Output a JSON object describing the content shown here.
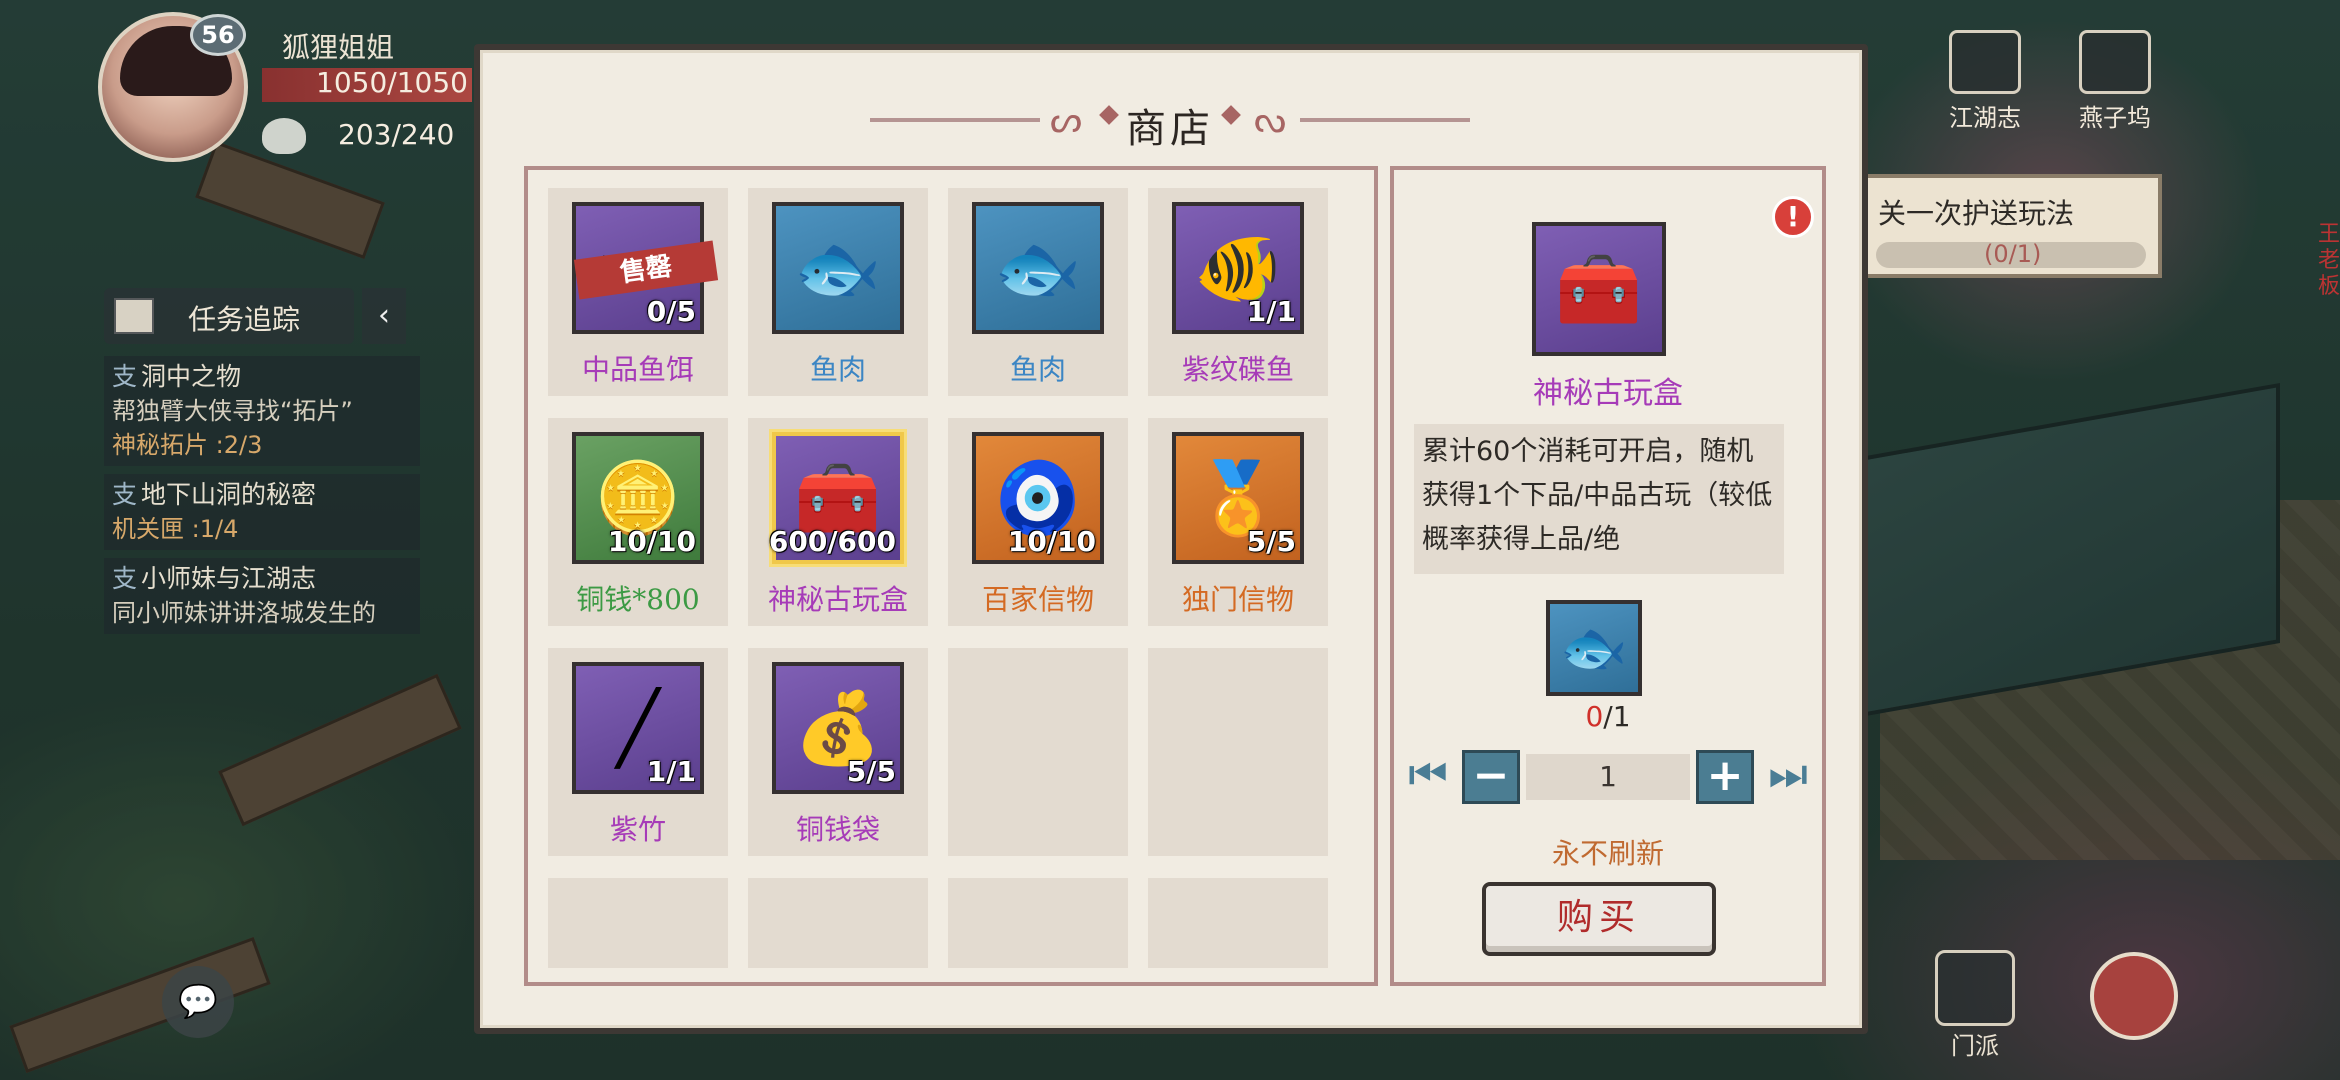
{
  "player": {
    "level": "56",
    "name": "狐狸姐姐",
    "hp": "1050/1050",
    "energy": "203/240"
  },
  "quest_tracker": {
    "header": "任务追踪",
    "collapse_icon": "chevron-left-icon",
    "quests": [
      {
        "tag": "支",
        "title": "洞中之物",
        "desc": "帮独臂大侠寻找“拓片”",
        "progress": "神秘拓片 :2/3"
      },
      {
        "tag": "支",
        "title": "地下山洞的秘密",
        "desc": "",
        "progress": "机关匣 :1/4"
      },
      {
        "tag": "支",
        "title": "小师妹与江湖志",
        "desc": "同小师妹讲讲洛城发生的",
        "progress": ""
      }
    ]
  },
  "hud_right": {
    "jianghu_label": "江湖志",
    "yanziwu_label": "燕子坞",
    "escort_text": "关一次护送玩法",
    "escort_progress": "(0/1)",
    "npc_name": "王老板",
    "sect_label": "门派"
  },
  "shop": {
    "title": "商店",
    "items": [
      {
        "name": "中品鱼饵",
        "stock": "0/5",
        "color": "purple",
        "frame": "purple",
        "icon": "bait-worm-icon",
        "soldout": "售罄",
        "glyph": "〰"
      },
      {
        "name": "鱼肉",
        "stock": "",
        "color": "blue",
        "frame": "blue",
        "icon": "fish-meat-icon",
        "glyph": "🐟"
      },
      {
        "name": "鱼肉",
        "stock": "",
        "color": "blue",
        "frame": "blue",
        "icon": "fish-meat-icon",
        "glyph": "🐟"
      },
      {
        "name": "紫纹碟鱼",
        "stock": "1/1",
        "color": "purple",
        "frame": "purple",
        "icon": "purple-fish-icon",
        "glyph": "🐠"
      },
      {
        "name": "铜钱*800",
        "stock": "10/10",
        "color": "green",
        "frame": "green",
        "icon": "copper-coin-icon",
        "glyph": "🪙"
      },
      {
        "name": "神秘古玩盒",
        "stock": "600/600",
        "color": "purple",
        "frame": "purple",
        "icon": "treasure-chest-icon",
        "glyph": "🧰",
        "selected": true
      },
      {
        "name": "百家信物",
        "stock": "10/10",
        "color": "orange",
        "frame": "orange",
        "icon": "jade-token-icon",
        "glyph": "🧿"
      },
      {
        "name": "独门信物",
        "stock": "5/5",
        "color": "orange",
        "frame": "orange",
        "icon": "jade-token-icon",
        "glyph": "🏅"
      },
      {
        "name": "紫竹",
        "stock": "1/1",
        "color": "purple",
        "frame": "purple",
        "icon": "bamboo-rod-icon",
        "glyph": "╱"
      },
      {
        "name": "铜钱袋",
        "stock": "5/5",
        "color": "purple",
        "frame": "purple",
        "icon": "coin-pouch-icon",
        "glyph": "💰"
      }
    ],
    "empty_cells": 6
  },
  "detail": {
    "name": "神秘古玩盒",
    "description": "累计60个消耗可开启，随机获得1个下品/中品古玩（较低概率获得上品/绝",
    "cost_have": "0",
    "cost_need": "/1",
    "quantity": "1",
    "refresh_note": "永不刷新",
    "buy_label": "购买",
    "alert": "!"
  },
  "colors": {
    "purple": "#a63bb8",
    "blue": "#3c86c4",
    "green": "#3c9a44",
    "orange": "#d46a23",
    "warning_red": "#d0302a"
  }
}
